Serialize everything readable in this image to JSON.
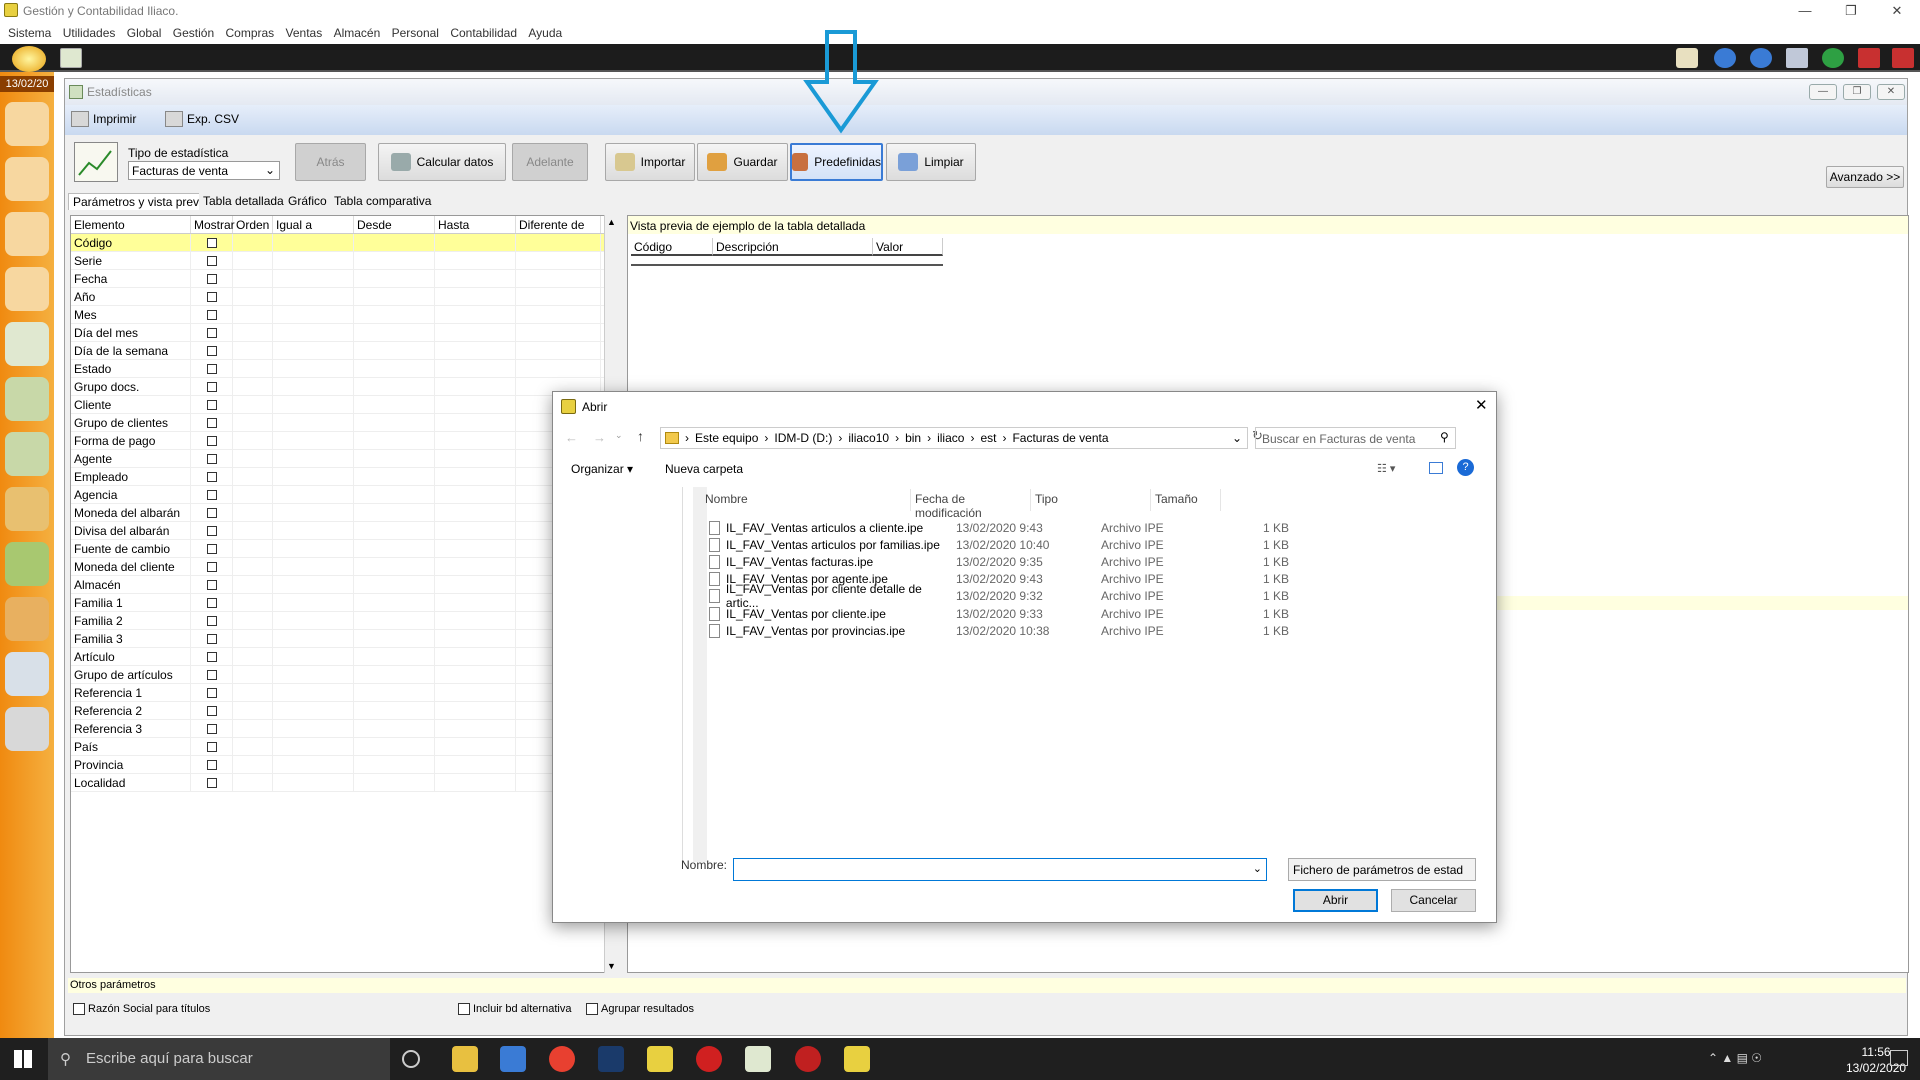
{
  "app": {
    "title": "Gestión y Contabilidad Iliaco.",
    "menu": [
      "Sistema",
      "Utilidades",
      "Global",
      "Gestión",
      "Compras",
      "Ventas",
      "Almacén",
      "Personal",
      "Contabilidad",
      "Ayuda"
    ],
    "date": "13/02/20"
  },
  "window": {
    "title": "Estadísticas",
    "toolbar": {
      "print": "Imprimir",
      "export": "Exp. CSV"
    },
    "tipo_label": "Tipo de estadística",
    "tipo_value": "Facturas de venta",
    "buttons": {
      "back": "Atrás",
      "calc": "Calcular datos",
      "forward": "Adelante",
      "import": "Importar",
      "save": "Guardar",
      "predefined": "Predefinidas",
      "clear": "Limpiar",
      "advanced": "Avanzado >>"
    },
    "tabs": [
      "Parámetros y vista previa",
      "Tabla detallada",
      "Gráfico",
      "Tabla comparativa"
    ],
    "grid_headers": [
      "Elemento",
      "Mostrar",
      "Orden",
      "Igual a",
      "Desde",
      "Hasta",
      "Diferente de"
    ],
    "elements": [
      "Código",
      "Serie",
      "Fecha",
      "Año",
      "Mes",
      "Día del mes",
      "Día de la semana",
      "Estado",
      "Grupo docs.",
      "Cliente",
      "Grupo de clientes",
      "Forma de pago",
      "Agente",
      "Empleado",
      "Agencia",
      "Moneda del albarán",
      "Divisa del albarán",
      "Fuente de cambio",
      "Moneda del cliente",
      "Almacén",
      "Familia 1",
      "Familia 2",
      "Familia 3",
      "Artículo",
      "Grupo de artículos",
      "Referencia 1",
      "Referencia 2",
      "Referencia 3",
      "País",
      "Provincia",
      "Localidad"
    ],
    "preview_title": "Vista previa de ejemplo de la tabla detallada",
    "preview_headers": [
      "Código",
      "Descripción",
      "Valor"
    ],
    "otros": "Otros parámetros",
    "checks": [
      "Razón Social para títulos",
      "Incluir bd alternativa",
      "Agrupar resultados"
    ]
  },
  "dialog": {
    "title": "Abrir",
    "path": [
      "Este equipo",
      "IDM-D (D:)",
      "iliaco10",
      "bin",
      "iliaco",
      "est",
      "Facturas de venta"
    ],
    "search_placeholder": "Buscar en Facturas de venta",
    "organize": "Organizar ▾",
    "new_folder": "Nueva carpeta",
    "columns": [
      "Nombre",
      "Fecha de modificación",
      "Tipo",
      "Tamaño"
    ],
    "files": [
      {
        "name": "IL_FAV_Ventas articulos a cliente.ipe",
        "date": "13/02/2020 9:43",
        "type": "Archivo IPE",
        "size": "1 KB"
      },
      {
        "name": "IL_FAV_Ventas articulos por familias.ipe",
        "date": "13/02/2020 10:40",
        "type": "Archivo IPE",
        "size": "1 KB"
      },
      {
        "name": "IL_FAV_Ventas facturas.ipe",
        "date": "13/02/2020 9:35",
        "type": "Archivo IPE",
        "size": "1 KB"
      },
      {
        "name": "IL_FAV_Ventas por agente.ipe",
        "date": "13/02/2020 9:43",
        "type": "Archivo IPE",
        "size": "1 KB"
      },
      {
        "name": "IL_FAV_Ventas por cliente detalle de artic...",
        "date": "13/02/2020 9:32",
        "type": "Archivo IPE",
        "size": "1 KB"
      },
      {
        "name": "IL_FAV_Ventas por cliente.ipe",
        "date": "13/02/2020 9:33",
        "type": "Archivo IPE",
        "size": "1 KB"
      },
      {
        "name": "IL_FAV_Ventas por provincias.ipe",
        "date": "13/02/2020 10:38",
        "type": "Archivo IPE",
        "size": "1 KB"
      }
    ],
    "name_label": "Nombre:",
    "filter": "Fichero de parámetros de estad",
    "open": "Abrir",
    "cancel": "Cancelar"
  },
  "taskbar": {
    "search": "Escribe aquí para buscar",
    "time": "11:56",
    "date": "13/02/2020"
  }
}
